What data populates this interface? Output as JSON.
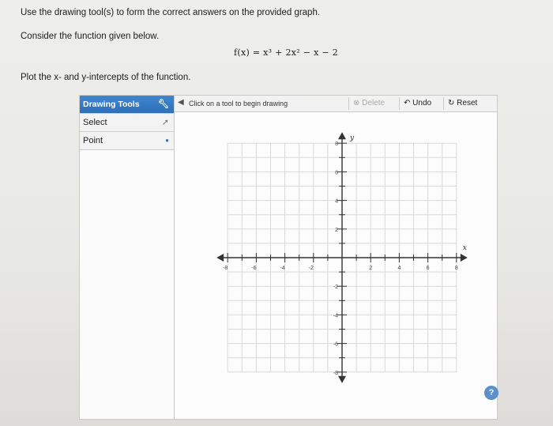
{
  "question": {
    "instruction": "Use the drawing tool(s) to form the correct answers on the provided graph.",
    "consider": "Consider the function given below.",
    "formula": "f(x) = x³ + 2x² − x − 2",
    "plot_instruction": "Plot the x- and y-intercepts of the function."
  },
  "tools": {
    "header": "Drawing Tools",
    "items": [
      {
        "label": "Select",
        "icon": "arrow-cursor-icon"
      },
      {
        "label": "Point",
        "icon": "dot-icon"
      }
    ],
    "header_icon": "wrench-icon"
  },
  "toolbar": {
    "hint": "Click on a tool to begin drawing",
    "delete_label": "Delete",
    "undo_label": "Undo",
    "reset_label": "Reset"
  },
  "graph": {
    "x_axis_label": "x",
    "y_axis_label": "y",
    "x_tick_labels": [
      "-8",
      "-6",
      "-4",
      "-2",
      "2",
      "4",
      "6",
      "8"
    ],
    "y_tick_labels": [
      "8",
      "6",
      "4",
      "2",
      "-2",
      "-4",
      "-6",
      "-8"
    ],
    "x_range": [
      -8,
      8
    ],
    "y_range": [
      -8,
      8
    ],
    "grid": true
  },
  "colors": {
    "accent": "#2f70b8",
    "grid": "#d9d9d9",
    "axis": "#333333"
  }
}
